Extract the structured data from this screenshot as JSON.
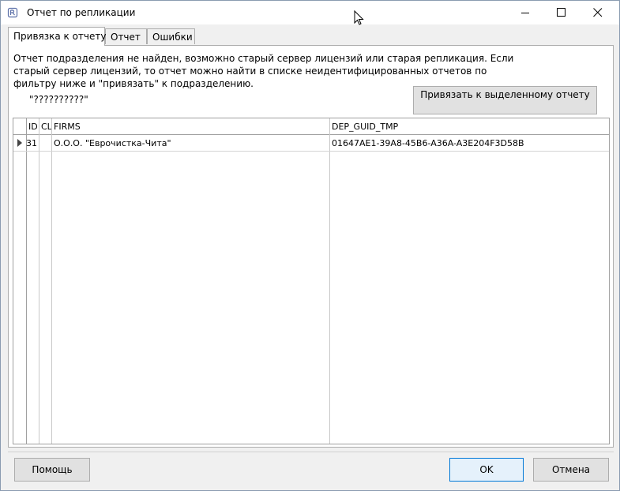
{
  "window": {
    "title": "Отчет по репликации"
  },
  "tabs": [
    {
      "label": "Привязка к отчету",
      "active": true
    },
    {
      "label": "Отчет",
      "active": false
    },
    {
      "label": "Ошибки",
      "active": false
    }
  ],
  "panel": {
    "message": "Отчет подразделения не найден, возможно старый сервер лицензий или старая репликация. Если старый сервер лицензий, то отчет можно найти в списке неидентифицированных отчетов по фильтру ниже и \"привязать\" к подразделению.",
    "filter": "\"??????????\"",
    "bind_button_label": "Привязать к выделенному отчету"
  },
  "grid": {
    "columns": [
      "ID",
      "CL",
      "FIRMS",
      "DEP_GUID_TMP"
    ],
    "rows": [
      {
        "id": "31",
        "cl": "",
        "firms": "О.О.О. \"Еврочистка-Чита\"",
        "dep_guid_tmp": "01647AE1-39A8-45B6-A36A-A3E204F3D58B"
      }
    ]
  },
  "footer": {
    "help_label": "Помощь",
    "ok_label": "OK",
    "cancel_label": "Отмена"
  },
  "colors": {
    "accent": "#0078d7",
    "button_face": "#e1e1e1",
    "window_bg": "#f0f0f0"
  }
}
